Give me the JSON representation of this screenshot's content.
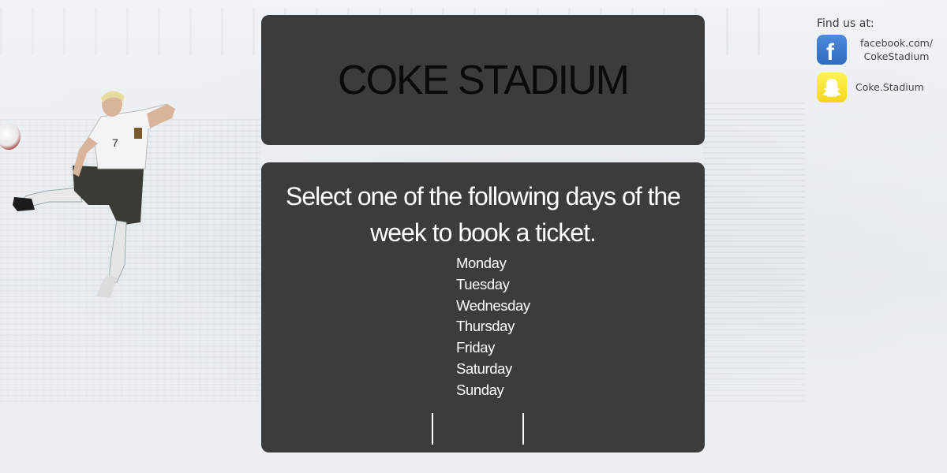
{
  "header": {
    "title": "COKE STADIUM"
  },
  "booking": {
    "instructions": "Select one of the following days of the week to book a ticket.",
    "days": [
      "Monday",
      "Tuesday",
      "Wednesday",
      "Thursday",
      "Friday",
      "Saturday",
      "Sunday"
    ]
  },
  "findus": {
    "label": "Find us at:",
    "facebook": {
      "line1": "facebook.com/",
      "line2": "CokeStadium",
      "icon": "facebook-icon",
      "color": "#3b73cc"
    },
    "snapchat": {
      "text": "Coke.Stadium",
      "icon": "snapchat-icon",
      "color": "#f9e231"
    }
  },
  "colors": {
    "panel": "#3c3c3c",
    "title_text": "#0a0a0a",
    "body_text": "#ffffff",
    "page_bg": "#e9edf0"
  }
}
